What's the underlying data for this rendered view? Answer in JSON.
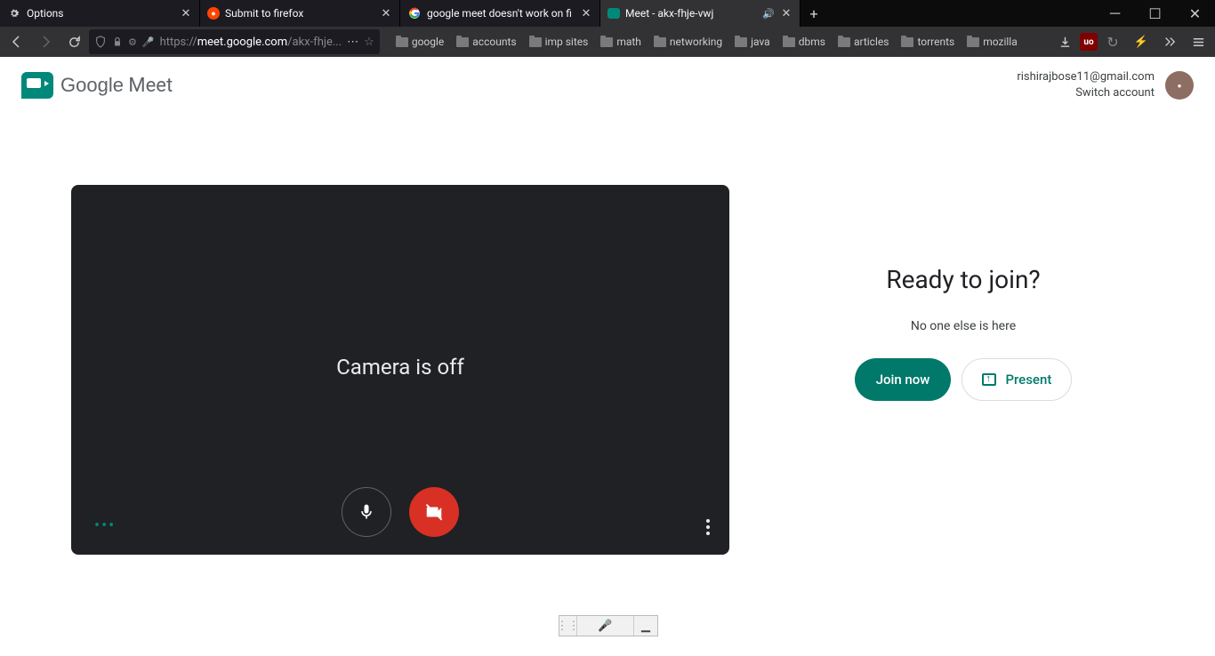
{
  "tabs": [
    {
      "title": "Options",
      "icon": "gear"
    },
    {
      "title": "Submit to firefox",
      "icon": "reddit"
    },
    {
      "title": "google meet doesn't work on fi",
      "icon": "google"
    },
    {
      "title": "Meet - akx-fhje-vwj",
      "icon": "meet",
      "active": true,
      "audio": true
    }
  ],
  "url": {
    "prefix": "https://",
    "domain": "meet.google.com",
    "path": "/akx-fhje"
  },
  "bookmarks": [
    "google",
    "accounts",
    "imp sites",
    "math",
    "networking",
    "java",
    "dbms",
    "articles",
    "torrents",
    "mozilla"
  ],
  "header": {
    "logo": "Google Meet",
    "email": "rishirajbose11@gmail.com",
    "switch": "Switch account"
  },
  "preview": {
    "status": "Camera is off"
  },
  "join": {
    "title": "Ready to join?",
    "status": "No one else is here",
    "join_label": "Join now",
    "present_label": "Present"
  }
}
